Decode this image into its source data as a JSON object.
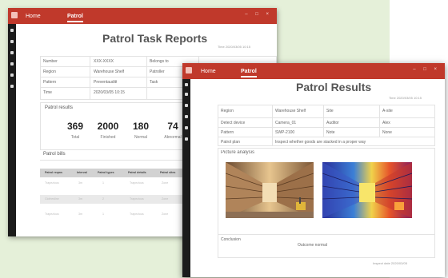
{
  "colors": {
    "titlebar": "#c0392b",
    "sidebar": "#1b1b1b",
    "background": "#e5f0d9"
  },
  "back_window": {
    "nav": [
      "Home",
      "Patrol"
    ],
    "title": "Patrol Task Reports",
    "meta": "Time 2020/03/05 10:15",
    "info": {
      "number_label": "Number",
      "number_value": "XXX-XXXX",
      "belongs_label": "Belongs to",
      "region_label": "Region",
      "region_value": "Warehouse Shelf",
      "patroller_label": "Patroller",
      "pattern_label": "Pattern",
      "pattern_value": "Preventauditt",
      "task_label": "Task",
      "time_label": "Time",
      "time_value": "2020/03/05  10:15"
    },
    "results_label": "Patrol results",
    "stats": [
      {
        "value": "369",
        "label": "Total"
      },
      {
        "value": "2000",
        "label": "Finished"
      },
      {
        "value": "180",
        "label": "Normal"
      },
      {
        "value": "74",
        "label": "Abnormal"
      }
    ],
    "bills_label": "Patrol bills",
    "table_headers": [
      "Patrol reqms",
      "Interval",
      "Patrol types",
      "Patrol details",
      "Patrol sites"
    ],
    "table_rows": [
      [
        "Trapezious",
        "3m",
        "1",
        "Trapezious",
        "Zone"
      ],
      [
        "Clothesline",
        "3m",
        "2",
        "Trapezious",
        "Zone"
      ],
      [
        "Trapezious",
        "3m",
        "1",
        "Trapezious",
        "Zone"
      ]
    ]
  },
  "front_window": {
    "nav": [
      "Home",
      "Patrol"
    ],
    "title": "Patrol Results",
    "meta": "Time 2020/03/05 10:15",
    "rows": [
      [
        "Region",
        "Warehouse Shelf",
        "Site",
        "A-site"
      ],
      [
        "Detect device",
        "Camera_01",
        "Auditor",
        "Alex"
      ],
      [
        "Pattern",
        "SWP-2100",
        "Note",
        "None"
      ]
    ],
    "plan_label": "Patrol plan",
    "plan_value": "Inspect whether goods are stacked in a proper way",
    "picture_label": "Picture analysis",
    "conclusion_label": "Conclusion",
    "conclusion_value": "Outcome normal",
    "footer": "Inspect date  2020/03/05"
  }
}
